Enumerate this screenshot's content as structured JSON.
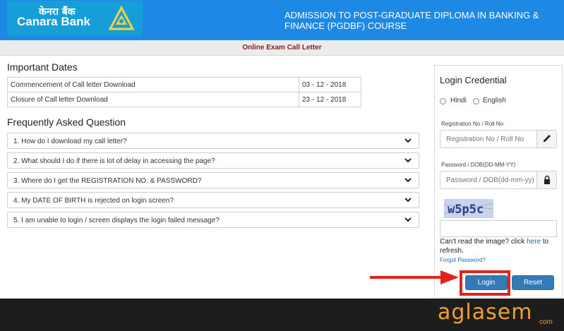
{
  "header": {
    "logo_hindi": "केनरा बैंक",
    "logo_english": "Canara Bank",
    "title": "ADMISSION TO POST-GRADUATE DIPLOMA IN BANKING & FINANCE (PGDBF) COURSE"
  },
  "subheader": {
    "label": "Online Exam Call Letter"
  },
  "important_dates": {
    "title": "Important Dates",
    "rows": [
      {
        "label": "Commencement of Call letter Download",
        "date": "03 - 12 - 2018"
      },
      {
        "label": "Closure of Call letter Download",
        "date": "23 - 12 - 2018"
      }
    ]
  },
  "faq": {
    "title": "Frequently Asked Question",
    "items": [
      "1. How do I download my call letter?",
      "2. What should I do if there is lot of delay in accessing the page?",
      "3. Where do I get the REGISTRATION NO. & PASSWORD?",
      "4. My DATE OF BIRTH is rejected on login screen?",
      "5. I am unable to login / screen displays the login failed message?"
    ]
  },
  "login": {
    "title": "Login Credential",
    "languages": [
      "Hindi",
      "English"
    ],
    "reg_label": "Registration No / Roll No",
    "reg_placeholder": "Registration No / Roll No",
    "pwd_label": "Password / DOB(DD-MM-YY)",
    "pwd_placeholder": "Password / DOB(dd-mm-yy)",
    "captcha_text": "w5p5c",
    "cant_read_prefix": "Can't read the image? click ",
    "cant_read_link": "here",
    "cant_read_suffix": " to refresh.",
    "forgot": "Forgot Password?",
    "login_button": "Login",
    "reset_button": "Reset"
  },
  "footer": {
    "brand": "aglasem",
    "brand_suffix": "com"
  },
  "colors": {
    "header_bg": "#1e88e5",
    "accent_red": "#e0231b",
    "button_blue": "#337ab7",
    "subheader_text": "#8b1a1a",
    "brand_orange": "#f0a030"
  }
}
